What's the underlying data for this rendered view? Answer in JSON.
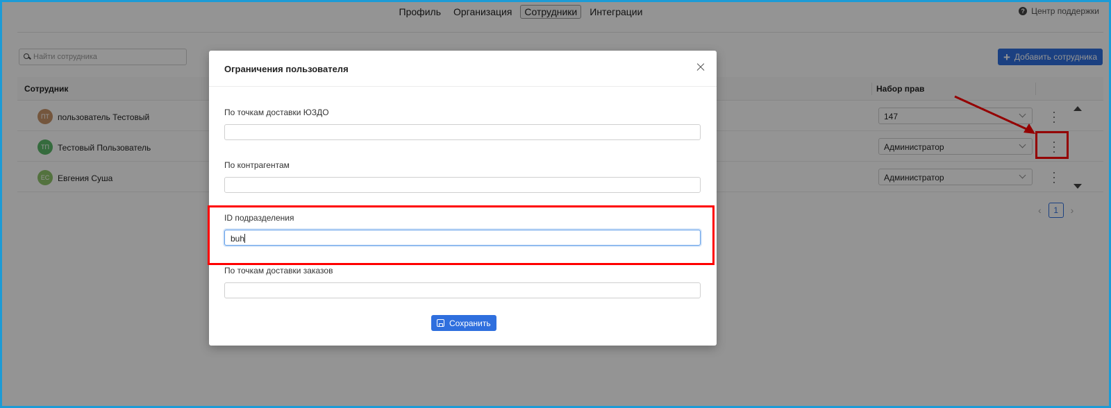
{
  "nav": {
    "tabs": [
      {
        "label": "Профиль",
        "active": false
      },
      {
        "label": "Организация",
        "active": false
      },
      {
        "label": "Сотрудники",
        "active": true
      },
      {
        "label": "Интеграции",
        "active": false
      }
    ],
    "support_label": "Центр поддержки"
  },
  "search": {
    "placeholder": "Найти сотрудника"
  },
  "add_button": {
    "label": "Добавить сотрудника"
  },
  "table": {
    "headers": {
      "employee": "Сотрудник",
      "rights": "Набор прав"
    },
    "rows": [
      {
        "initials": "ПТ",
        "name": "пользователь Тестовый",
        "rights": "147",
        "avatar_color": "#c8946a"
      },
      {
        "initials": "ТП",
        "name": "Тестовый Пользователь",
        "rights": "Администратор",
        "avatar_color": "#5cb86a"
      },
      {
        "initials": "ЕС",
        "name": "Евгения Суша",
        "rights": "Администратор",
        "avatar_color": "#8fc46b"
      }
    ]
  },
  "pagination": {
    "current_page": "1"
  },
  "modal": {
    "title": "Ограничения пользователя",
    "fields": [
      {
        "label": "По точкам доставки ЮЗДО",
        "value": ""
      },
      {
        "label": "По контрагентам",
        "value": ""
      },
      {
        "label": "ID подразделения",
        "value": "buh"
      },
      {
        "label": "По точкам доставки заказов",
        "value": ""
      }
    ],
    "save_label": "Сохранить"
  },
  "colors": {
    "accent": "#2f6fde",
    "highlight": "#ff0000",
    "frame": "#1c9bd6"
  }
}
